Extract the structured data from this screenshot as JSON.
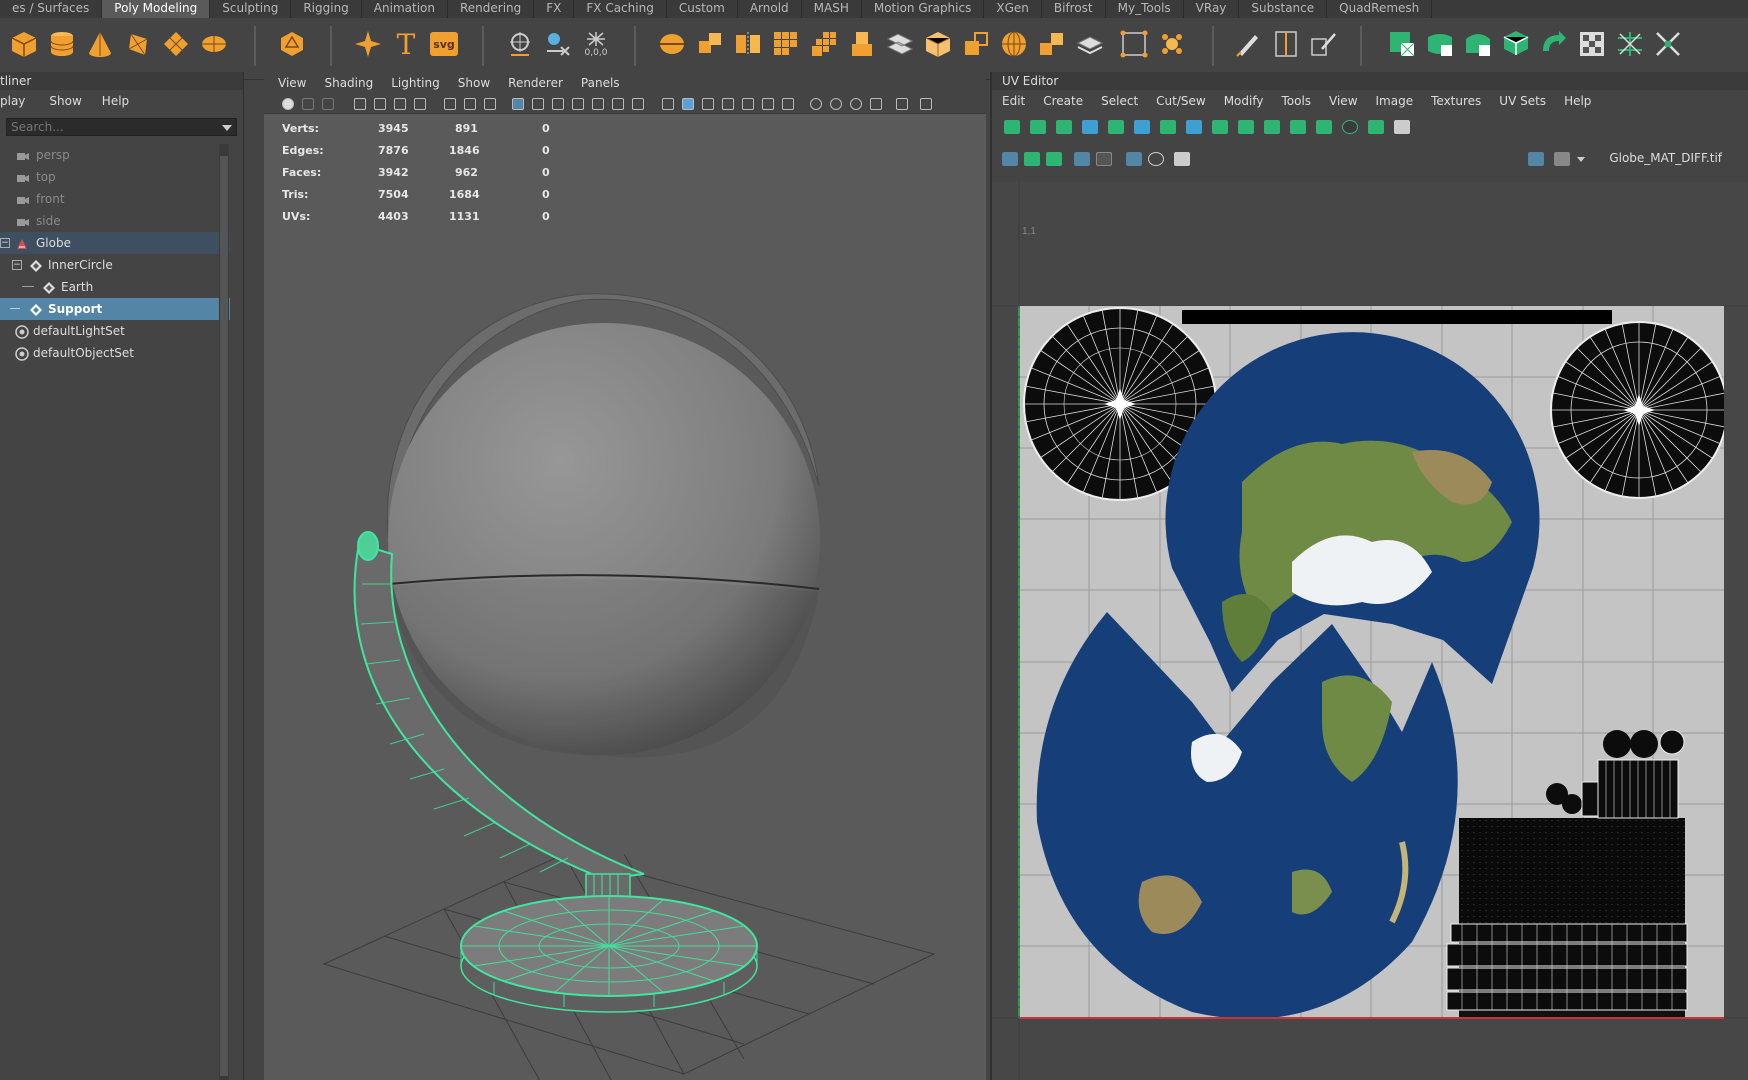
{
  "shelf": {
    "tabs": [
      "es / Surfaces",
      "Poly Modeling",
      "Sculpting",
      "Rigging",
      "Animation",
      "Rendering",
      "FX",
      "FX Caching",
      "Custom",
      "Arnold",
      "MASH",
      "Motion Graphics",
      "XGen",
      "Bifrost",
      "My_Tools",
      "VRay",
      "Substance",
      "QuadRemesh"
    ],
    "active_tab": "Poly Modeling",
    "text_icon_label": "T",
    "svg_icon_label": "svg",
    "coords_label": "0,0,0"
  },
  "outliner": {
    "title": "tliner",
    "menu": [
      "play",
      "Show",
      "Help"
    ],
    "search_placeholder": "Search...",
    "items": [
      {
        "label": "persp",
        "kind": "camera"
      },
      {
        "label": "top",
        "kind": "camera"
      },
      {
        "label": "front",
        "kind": "camera"
      },
      {
        "label": "side",
        "kind": "camera"
      },
      {
        "label": "Globe",
        "kind": "group"
      },
      {
        "label": "InnerCircle",
        "kind": "mesh"
      },
      {
        "label": "Earth",
        "kind": "mesh"
      },
      {
        "label": "Support",
        "kind": "mesh"
      },
      {
        "label": "defaultLightSet",
        "kind": "set"
      },
      {
        "label": "defaultObjectSet",
        "kind": "set"
      }
    ]
  },
  "viewport": {
    "menu": [
      "View",
      "Shading",
      "Lighting",
      "Show",
      "Renderer",
      "Panels"
    ],
    "hud": [
      {
        "label": "Verts:",
        "a": "3945",
        "b": "891",
        "c": "0"
      },
      {
        "label": "Edges:",
        "a": "7876",
        "b": "1846",
        "c": "0"
      },
      {
        "label": "Faces:",
        "a": "3942",
        "b": "962",
        "c": "0"
      },
      {
        "label": "Tris:",
        "a": "7504",
        "b": "1684",
        "c": "0"
      },
      {
        "label": "UVs:",
        "a": "4403",
        "b": "1131",
        "c": "0"
      }
    ]
  },
  "uv_editor": {
    "title": "UV Editor",
    "menu": [
      "Edit",
      "Create",
      "Select",
      "Cut/Sew",
      "Modify",
      "Tools",
      "View",
      "Image",
      "Textures",
      "UV Sets",
      "Help"
    ],
    "texture_name": "Globe_MAT_DIFF.tif",
    "grid_label": "1,1"
  },
  "colors": {
    "accent_orange": "#f0a030",
    "accent_teal": "#2fb573",
    "selection_blue": "#5285a6",
    "wire_green": "#3ee6a0",
    "ocean_blue": "#163f7a"
  }
}
